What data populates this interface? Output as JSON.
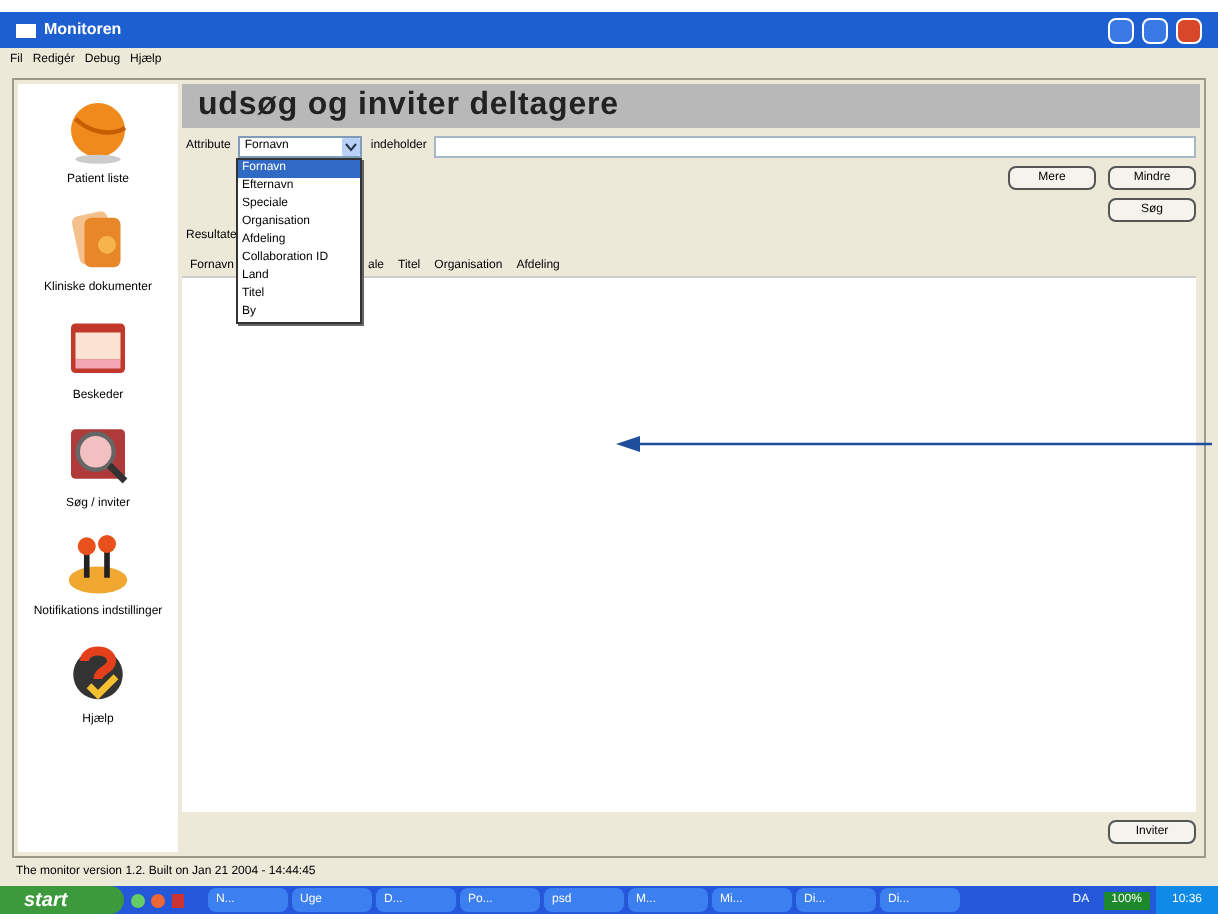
{
  "window": {
    "title": "Monitoren"
  },
  "menu": [
    "Fil",
    "Redigér",
    "Debug",
    "Hjælp"
  ],
  "sidebar": {
    "items": [
      {
        "label": "Patient liste",
        "kind": "ball"
      },
      {
        "label": "Kliniske dokumenter",
        "kind": "docs"
      },
      {
        "label": "Beskeder",
        "kind": "folder"
      },
      {
        "label": "Søg / inviter",
        "kind": "search"
      },
      {
        "label": "Notifikations indstillinger",
        "kind": "joystick"
      },
      {
        "label": "Hjælp",
        "kind": "help"
      }
    ]
  },
  "heading": "udsøg og inviter deltagere",
  "search": {
    "attribute_label": "Attribute",
    "attribute_value": "Fornavn",
    "contains_label": "indeholder",
    "dropdown_expanded": true,
    "options": [
      {
        "label": "Fornavn",
        "selected": true
      },
      {
        "label": "Efternavn",
        "selected": false
      },
      {
        "label": "Speciale",
        "selected": false
      },
      {
        "label": "Organisation",
        "selected": false
      },
      {
        "label": "Afdeling",
        "selected": false
      },
      {
        "label": "Collaboration ID",
        "selected": false
      },
      {
        "label": "Land",
        "selected": false
      },
      {
        "label": "Titel",
        "selected": false
      },
      {
        "label": "By",
        "selected": false
      }
    ]
  },
  "buttons": {
    "more": "Mere",
    "less": "Mindre",
    "search": "Søg",
    "invite": "Inviter"
  },
  "results": {
    "label": "Resultate",
    "columns": [
      "Fornavn",
      "ale",
      "Titel",
      "Organisation",
      "Afdeling"
    ]
  },
  "status_bar": "The monitor version 1.2. Built on Jan 21 2004 - 14:44:45",
  "taskbar": {
    "start": "start",
    "items": [
      "N...",
      "Uge",
      "D...",
      "Po...",
      "psd",
      "M...",
      "Mi...",
      "Di...",
      "Di..."
    ],
    "language": "DA",
    "battery": "100%",
    "clock": "10:36"
  }
}
